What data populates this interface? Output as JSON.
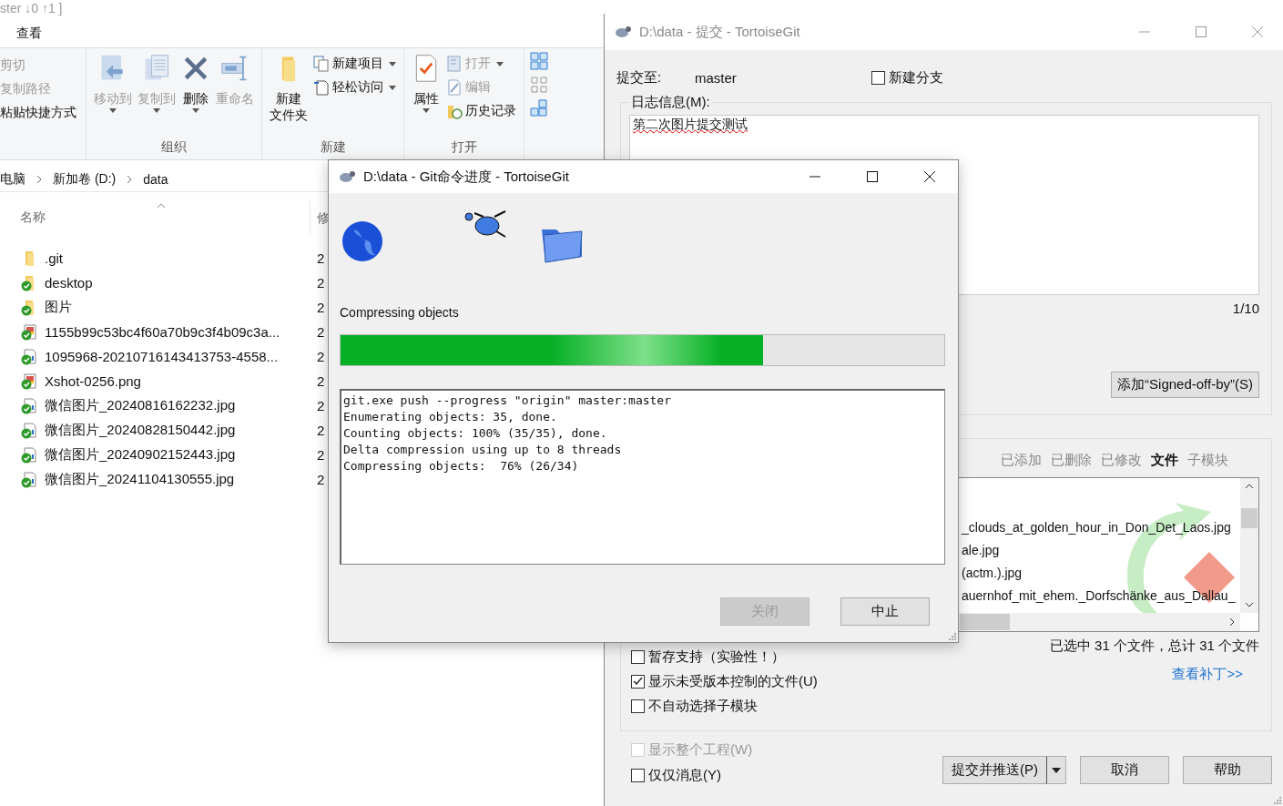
{
  "explorer": {
    "title": "ster ↓0 ↑1 ]",
    "tab": "查看",
    "clipboard": [
      {
        "label": "剪切",
        "disabled": true
      },
      {
        "label": "复制路径",
        "disabled": true
      },
      {
        "label": "粘贴快捷方式",
        "disabled": false
      }
    ],
    "groups": [
      {
        "label": "组织",
        "buttons": [
          {
            "kind": "move",
            "lines": [
              "移动到"
            ],
            "disabled": true,
            "dropdown": true
          },
          {
            "kind": "copy",
            "lines": [
              "复制到"
            ],
            "disabled": true,
            "dropdown": true
          },
          {
            "kind": "delete",
            "lines": [
              "删除"
            ],
            "disabled": false,
            "dropdown": true
          },
          {
            "kind": "rename",
            "lines": [
              "重命名"
            ],
            "disabled": true,
            "dropdown": false
          }
        ]
      },
      {
        "label": "新建",
        "buttons": [
          {
            "kind": "folder",
            "lines": [
              "新建",
              "文件夹"
            ],
            "disabled": false,
            "dropdown": false
          }
        ],
        "small": [
          {
            "kind": "new-item",
            "label": "新建项目",
            "disabled": false,
            "dropdown": true
          },
          {
            "kind": "easy-access",
            "label": "轻松访问",
            "disabled": false,
            "dropdown": true
          }
        ]
      },
      {
        "label": "打开",
        "buttons": [
          {
            "kind": "properties",
            "lines": [
              "属性"
            ],
            "disabled": false,
            "dropdown": true
          }
        ],
        "small": [
          {
            "kind": "open",
            "label": "打开",
            "disabled": true,
            "dropdown": true
          },
          {
            "kind": "edit",
            "label": "编辑",
            "disabled": true,
            "dropdown": false
          },
          {
            "kind": "history",
            "label": "历史记录",
            "disabled": false,
            "dropdown": false
          }
        ]
      }
    ],
    "breadcrumb": [
      "电脑",
      "新加卷 (D:)",
      "data"
    ],
    "columns": [
      "名称",
      "修"
    ],
    "files": [
      {
        "name": ".git",
        "kind": "folder",
        "tracked": false,
        "date": "2"
      },
      {
        "name": "desktop",
        "kind": "folder",
        "tracked": true,
        "date": "2"
      },
      {
        "name": "图片",
        "kind": "folder",
        "tracked": true,
        "date": "2"
      },
      {
        "name": "1155b99c53bc4f60a70b9c3f4b09c3a...",
        "kind": "image",
        "tracked": true,
        "date": "2"
      },
      {
        "name": "1095968-20210716143413753-4558...",
        "kind": "file",
        "tracked": true,
        "date": "2"
      },
      {
        "name": "Xshot-0256.png",
        "kind": "image",
        "tracked": true,
        "date": "2"
      },
      {
        "name": "微信图片_20240816162232.jpg",
        "kind": "file",
        "tracked": true,
        "date": "2"
      },
      {
        "name": "微信图片_20240828150442.jpg",
        "kind": "file",
        "tracked": true,
        "date": "2"
      },
      {
        "name": "微信图片_20240902152443.jpg",
        "kind": "file",
        "tracked": true,
        "date": "2"
      },
      {
        "name": "微信图片_20241104130555.jpg",
        "kind": "file",
        "tracked": true,
        "date": "2"
      }
    ]
  },
  "commit": {
    "title": "D:\\data - 提交 - TortoiseGit",
    "commit_to_label": "提交至:",
    "branch": "master",
    "new_branch": {
      "label": "新建分支",
      "checked": false
    },
    "message_label": "日志信息(M):",
    "message": "第二次图片提交测试",
    "counter": "1/10",
    "signoff_button": "添加“Signed-off-by”(S)",
    "filters": [
      {
        "label": "已添加",
        "selected": false
      },
      {
        "label": "已删除",
        "selected": false
      },
      {
        "label": "已修改",
        "selected": false
      },
      {
        "label": "文件",
        "selected": true
      },
      {
        "label": "子模块",
        "selected": false
      }
    ],
    "files": [
      "_clouds_at_golden_hour_in_Don_Det_Laos.jpg",
      "ale.jpg",
      "(actm.).jpg",
      "auernhof_mit_ehem._Dorfschänke_aus_Dallau_"
    ],
    "summary": "已选中 31 个文件，总计 31 个文件",
    "patch_link": "查看补丁>>",
    "options": [
      {
        "label": "暂存支持（实验性！）",
        "checked": false,
        "disabled": false
      },
      {
        "label": "显示未受版本控制的文件(U)",
        "checked": true,
        "disabled": false
      },
      {
        "label": "不自动选择子模块",
        "checked": false,
        "disabled": false
      }
    ],
    "bottom_options": [
      {
        "label": "显示整个工程(W)",
        "checked": false,
        "disabled": true
      },
      {
        "label": "仅仅消息(Y)",
        "checked": false,
        "disabled": false
      }
    ],
    "buttons": [
      {
        "label": "提交并推送(P)",
        "dropdown": true
      },
      {
        "label": "取消",
        "dropdown": false
      },
      {
        "label": "帮助",
        "dropdown": false
      }
    ]
  },
  "progress": {
    "title": "D:\\data - Git命令进度 - TortoiseGit",
    "status": "Compressing objects",
    "level": 0.7,
    "log": [
      "git.exe push --progress \"origin\" master:master",
      "Enumerating objects: 35, done.",
      "Counting objects: 100% (35/35), done.",
      "Delta compression using up to 8 threads",
      "Compressing objects:  76% (26/34)"
    ],
    "buttons": [
      {
        "label": "关闭",
        "disabled": true
      },
      {
        "label": "中止",
        "disabled": false
      }
    ]
  }
}
